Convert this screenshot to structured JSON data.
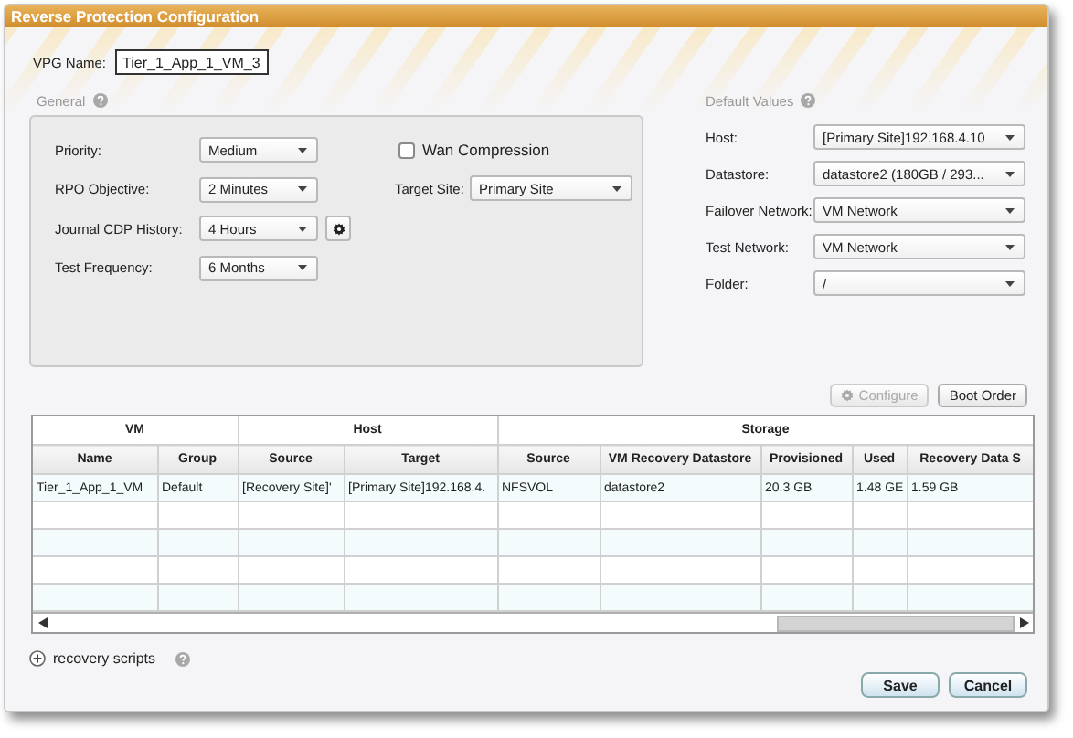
{
  "window": {
    "title": "Reverse Protection Configuration"
  },
  "vpg_name": {
    "label": "VPG Name:",
    "value": "Tier_1_App_1_VM_3"
  },
  "general": {
    "title": "General",
    "fields": [
      {
        "kind": "select",
        "label": "Priority:",
        "value": "Medium"
      },
      {
        "kind": "select",
        "label": "RPO Objective:",
        "value": "2 Minutes"
      },
      {
        "kind": "select_with_settings",
        "label": "Journal CDP History:",
        "value": "4 Hours"
      },
      {
        "kind": "select",
        "label": "Test Frequency:",
        "value": "6 Months"
      }
    ],
    "wan_compression": {
      "label": "Wan Compression",
      "checked": false
    },
    "target_site": {
      "label": "Target Site:",
      "value": "Primary Site"
    }
  },
  "default_values": {
    "title": "Default Values",
    "fields": [
      {
        "label": "Host:",
        "value": "[Primary Site]192.168.4.10"
      },
      {
        "label": "Datastore:",
        "value": "datastore2 (180GB / 293..."
      },
      {
        "label": "Failover Network:",
        "value": "VM Network"
      },
      {
        "label": "Test Network:",
        "value": "VM Network"
      },
      {
        "label": "Folder:",
        "value": "/"
      }
    ]
  },
  "table_buttons": [
    {
      "label": "Configure",
      "disabled": true
    },
    {
      "label": "Boot Order",
      "disabled": false
    }
  ],
  "table": {
    "groups": [
      {
        "label": "VM",
        "columns": [
          "Name",
          "Group"
        ]
      },
      {
        "label": "Host",
        "columns": [
          "Source",
          "Target"
        ]
      },
      {
        "label": "Storage",
        "columns": [
          "Source",
          "VM Recovery Datastore",
          "Provisioned",
          "Used",
          "Recovery Data S"
        ]
      }
    ],
    "rows": [
      [
        "Tier_1_App_1_VM",
        "Default",
        "[Recovery Site]'",
        "[Primary Site]192.168.4.",
        "NFSVOL",
        "datastore2",
        "20.3 GB",
        "1.48 GE",
        "1.59 GB"
      ]
    ]
  },
  "recovery_scripts": {
    "label": "recovery scripts",
    "expanded": false
  },
  "buttons": [
    "Save",
    "Cancel"
  ]
}
